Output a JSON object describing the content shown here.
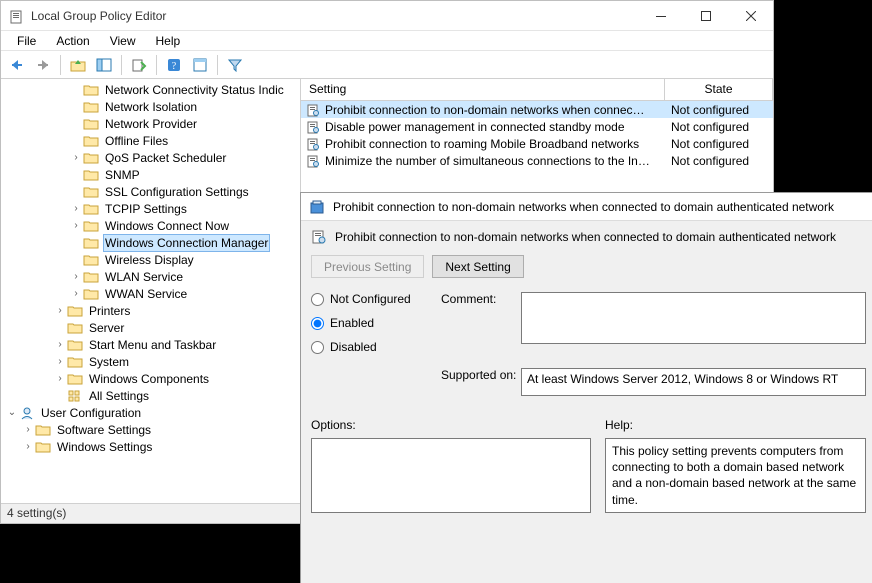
{
  "window": {
    "title": "Local Group Policy Editor"
  },
  "menu": [
    "File",
    "Action",
    "View",
    "Help"
  ],
  "tree": [
    {
      "indent": 4,
      "expand": "",
      "label": "Network Connectivity Status Indic"
    },
    {
      "indent": 4,
      "expand": "",
      "label": "Network Isolation"
    },
    {
      "indent": 4,
      "expand": "",
      "label": "Network Provider"
    },
    {
      "indent": 4,
      "expand": "",
      "label": "Offline Files"
    },
    {
      "indent": 4,
      "expand": ">",
      "label": "QoS Packet Scheduler"
    },
    {
      "indent": 4,
      "expand": "",
      "label": "SNMP"
    },
    {
      "indent": 4,
      "expand": "",
      "label": "SSL Configuration Settings"
    },
    {
      "indent": 4,
      "expand": ">",
      "label": "TCPIP Settings"
    },
    {
      "indent": 4,
      "expand": ">",
      "label": "Windows Connect Now"
    },
    {
      "indent": 4,
      "expand": "",
      "label": "Windows Connection Manager",
      "selected": true
    },
    {
      "indent": 4,
      "expand": "",
      "label": "Wireless Display"
    },
    {
      "indent": 4,
      "expand": ">",
      "label": "WLAN Service"
    },
    {
      "indent": 4,
      "expand": ">",
      "label": "WWAN Service"
    },
    {
      "indent": 3,
      "expand": ">",
      "label": "Printers"
    },
    {
      "indent": 3,
      "expand": "",
      "label": "Server"
    },
    {
      "indent": 3,
      "expand": ">",
      "label": "Start Menu and Taskbar"
    },
    {
      "indent": 3,
      "expand": ">",
      "label": "System"
    },
    {
      "indent": 3,
      "expand": ">",
      "label": "Windows Components"
    },
    {
      "indent": 3,
      "expand": "",
      "label": "All Settings",
      "special": "all"
    },
    {
      "indent": 0,
      "expand": "v",
      "label": "User Configuration",
      "special": "user"
    },
    {
      "indent": 1,
      "expand": ">",
      "label": "Software Settings"
    },
    {
      "indent": 1,
      "expand": ">",
      "label": "Windows Settings"
    }
  ],
  "columns": {
    "setting": "Setting",
    "state": "State"
  },
  "rows": [
    {
      "setting": "Prohibit connection to non-domain networks when connec…",
      "state": "Not configured",
      "sel": true
    },
    {
      "setting": "Disable power management in connected standby mode",
      "state": "Not configured"
    },
    {
      "setting": "Prohibit connection to roaming Mobile Broadband networks",
      "state": "Not configured"
    },
    {
      "setting": "Minimize the number of simultaneous connections to the In…",
      "state": "Not configured"
    }
  ],
  "dialog": {
    "title": "Prohibit connection to non-domain networks when connected to domain authenticated network",
    "inner_label": "Prohibit connection to non-domain networks when connected to domain authenticated network",
    "prev": "Previous Setting",
    "next": "Next Setting",
    "radios": {
      "nc": "Not Configured",
      "en": "Enabled",
      "di": "Disabled",
      "value": "en"
    },
    "comment_label": "Comment:",
    "comment_value": "",
    "supported_label": "Supported on:",
    "supported_value": "At least Windows Server 2012, Windows 8 or Windows RT",
    "options_label": "Options:",
    "help_label": "Help:",
    "help_text": "This policy setting prevents computers from connecting to both a domain based network and a non-domain based network at the same time."
  },
  "status": "4 setting(s)"
}
